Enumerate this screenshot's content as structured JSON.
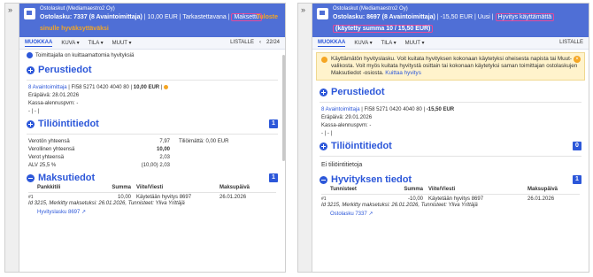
{
  "left": {
    "gutter": "»",
    "org": "Ostolaskut (Mediamaestro2 Oy)",
    "title_bold": "Ostolasku: 7337 (8 Avaintoimittaja)",
    "title_rest": " | 10,00 EUR | Tarkastettavana |",
    "status": "Maksettu",
    "warn_right": "Tuloste",
    "warning": "sinulle hyväksyttäväksi",
    "toolbar": {
      "tab1": "MUOKKAA",
      "tab2": "KUVA ▾",
      "tab3": "TILA ▾",
      "tab4": "MUUT ▾",
      "right1": "LISTALLE",
      "right2": "‹",
      "pager": "22/24"
    },
    "info": "Toimittajalla on kuittaamattomia hyvityksiä",
    "basic": {
      "title": "Perustiedot",
      "supplier_link": "8 Avaintoimittaja",
      "supplier_rest": " | FI58 5271 0420 4040 80 | ",
      "amount": "10,00 EUR",
      "due": "Eräpäivä: 28.01.2026",
      "discount": "Kassa-alennuspvm: -",
      "dashes": "- | - |"
    },
    "accounting": {
      "title": "Tiliöintitiedot",
      "badge": "1",
      "rows": [
        {
          "k": "Verotön yhteensä",
          "v": "7,97",
          "extra": "Tiliöimättä: 0,00 EUR",
          "bold": false
        },
        {
          "k": "Verollinen yhteensä",
          "v": "10,00",
          "extra": "",
          "bold": true
        },
        {
          "k": "Verot yhteensä",
          "v": "2,03",
          "extra": "",
          "bold": false
        },
        {
          "k": "ALV 25,5 %",
          "v": "(10,00) 2,03",
          "extra": "",
          "bold": false
        }
      ]
    },
    "payments": {
      "title": "Maksutiedot",
      "badge": "1",
      "headers": [
        "Pankkitili",
        "Summa",
        "Viite/Viesti",
        "Maksupäivä"
      ],
      "row": {
        "num": "#1",
        "amount": "10,00",
        "ref": "Käytetään hyvitys 8697",
        "date": "26.01.2026"
      },
      "note": "Id 3215, Merkitty maksetuksi: 26.01.2026, Tunnisteet: Yliva Yrittäjä",
      "link": "Hyvityslasku 8697"
    }
  },
  "right": {
    "gutter": "»",
    "org": "Ostolaskut (Mediamaestro2 Oy)",
    "title_bold": "Ostolasku: 8697 (8 Avaintoimittaja)",
    "title_rest": " | -15,50 EUR | Uusi |",
    "status": "Hyvitys käyttämättä",
    "used": "(käytetty summa 10 / 15,50 EUR)",
    "toolbar": {
      "tab1": "MUOKKAA",
      "tab2": "KUVA ▾",
      "tab3": "TILA ▾",
      "tab4": "MUUT ▾",
      "right1": "LISTALLE"
    },
    "banner": "Käyttämätön hyvityslasku. Voit kuitata hyvityksen kokonaan käytetyksi oheisesta napista tai Muut-valikosta. Voit myös kuitata hyvitystä osittain tai kokonaan käytetyksi saman toimittajan ostolaskujen Maksutiedot -osiosta.",
    "banner_link": "Kuittaa hyvitys",
    "basic": {
      "title": "Perustiedot",
      "supplier_link": "8 Avaintoimittaja",
      "supplier_rest": " | FI58 5271 0420 4040 80 | ",
      "amount": "-15,50 EUR",
      "due": "Eräpäivä: 29.01.2026",
      "discount": "Kassa-alennuspvm: -",
      "dashes": "- | - |"
    },
    "accounting": {
      "title": "Tiliöintitiedot",
      "badge": "0",
      "empty": "Ei tiliöintitietoja"
    },
    "credit": {
      "title": "Hyvityksen tiedot",
      "badge": "1",
      "headers": [
        "Tunnisteet",
        "Summa",
        "Viite/Viesti",
        "Maksupäivä"
      ],
      "row": {
        "num": "#1",
        "amount": "-10,00",
        "ref": "Käytetään hyvitys 8697",
        "date": "26.01.2026"
      },
      "note": "Id 3215, Merkitty maksetuksi: 26.01.2026, Tunnisteet: Yliva Yrittäjä",
      "link": "Ostolasku 7337"
    }
  }
}
